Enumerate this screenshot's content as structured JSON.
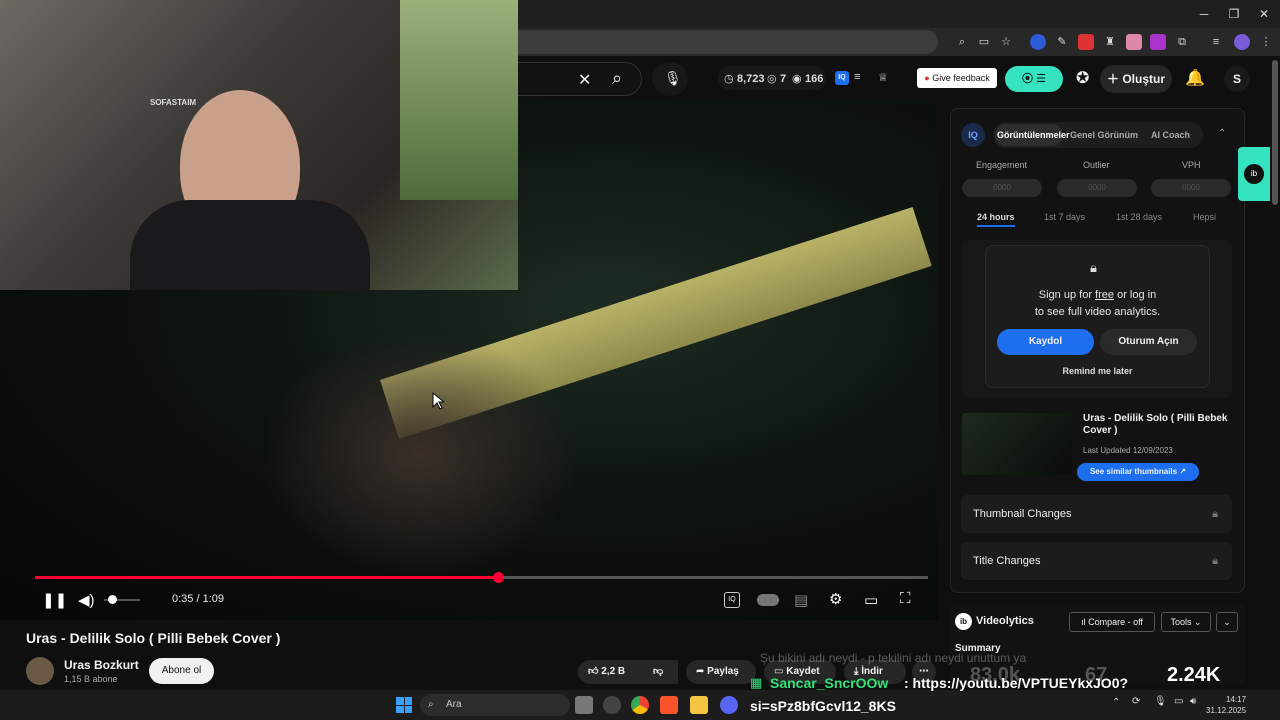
{
  "browser": {
    "minimize": "─",
    "maximize": "❐",
    "close": "✕"
  },
  "header": {
    "stats": {
      "views": "8,723",
      "likes": "7",
      "watching": "166"
    },
    "feedback_label": "Give feedback",
    "create_label": "Oluştur",
    "profile_initial": "S"
  },
  "player": {
    "time": "0:35 / 1:09",
    "progress": 0.518
  },
  "video": {
    "title": "Uras - Delilik Solo ( Pilli Bebek Cover )",
    "channel": "Uras Bozkurt",
    "subscribers": "1,15 B abone",
    "subscribe_label": "Abone ol",
    "likes": "2,2 B",
    "share_label": "Paylaş",
    "save_label": "Kaydet",
    "download_label": "İndir"
  },
  "vidiq": {
    "tabs": [
      "Görüntülenmeler",
      "Genel Görünüm",
      "AI Coach"
    ],
    "metrics": [
      "Engagement",
      "Outlier",
      "VPH"
    ],
    "metric_placeholder": "0000",
    "ranges": [
      "24 hours",
      "1st 7 days",
      "1st 28 days",
      "Hepsi"
    ],
    "login_line1a": "Sign up for ",
    "login_free": "free",
    "login_line1b": " or log in",
    "login_line2": "to see full video analytics.",
    "signup_label": "Kaydol",
    "login_label": "Oturum Açın",
    "remind_label": "Remind me later",
    "thumb_title": "Uras - Delilik Solo ( Pilli Bebek Cover )",
    "thumb_updated": "Last Updated 12/09/2023",
    "similar_label": "See similar thumbnails ↗",
    "thumbnail_changes": "Thumbnail Changes",
    "title_changes": "Title Changes"
  },
  "videolytics": {
    "title": "Videolytics",
    "compare_label": "Compare - off",
    "tools_label": "Tools",
    "summary_label": "Summary",
    "values": [
      "83.0k",
      "67",
      "2.24K"
    ]
  },
  "chat": {
    "ghost": "Şu bikini adı neydi - p tekilini adı neydi unuttum ya",
    "user": "Sancar_SncrOOw",
    "message": ": https://youtu.be/VPTUEYkxJO0?",
    "message2": "si=sPz8bfGcvl12_8KS"
  },
  "taskbar": {
    "search_label": "Ara",
    "time": "14:17",
    "date": "31.12.2025"
  },
  "overlay": {
    "webcam_text": "SOFASTAIM"
  }
}
